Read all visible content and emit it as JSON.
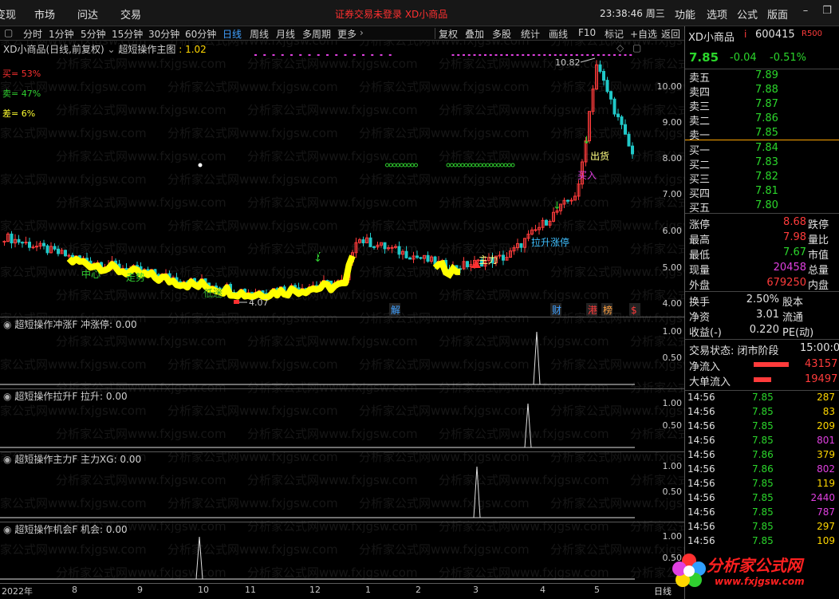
{
  "menu": {
    "items": [
      "变现",
      "市场",
      "问达",
      "交易"
    ],
    "status": "证券交易未登录  XD小商品",
    "clock": "23:38:46 周三",
    "right_items": [
      "功能",
      "选项",
      "公式",
      "版面"
    ]
  },
  "toolbar": {
    "periods": [
      "分时",
      "1分钟",
      "5分钟",
      "15分钟",
      "30分钟",
      "60分钟",
      "日线",
      "周线",
      "月线",
      "多周期",
      "更多"
    ],
    "active": "日线",
    "tools": [
      "复权",
      "叠加",
      "多股",
      "统计",
      "画线",
      "F10",
      "标记",
      "+自选",
      "返回"
    ]
  },
  "main_chart": {
    "stock": "XD小商品(日线,前复权)",
    "indicator": "超短操作主图",
    "indicator_value": "1.02",
    "signals": [
      {
        "label": "买= 53%",
        "cls": "sell"
      },
      {
        "label": "卖= 47%",
        "cls": "buy"
      },
      {
        "label": "差= 6%",
        "cls": "diff"
      }
    ],
    "high_label": "10.82",
    "low_label": "4.07",
    "annotations": {
      "chuhuo": "出货",
      "mairu": "买入",
      "lasheng": "拉升涨停",
      "zhuli": "主力",
      "zhongxin": "中心",
      "zoushi": "走势",
      "jiaxia": "低迷"
    },
    "event_tags": [
      "解",
      "财",
      "港",
      "榜",
      "$"
    ],
    "price_axis": [
      "10.00",
      "9.00",
      "8.00",
      "7.00",
      "6.00",
      "5.00",
      "4.00"
    ]
  },
  "sub_panes": [
    {
      "name": "超短操作冲涨F",
      "label": "冲涨停: 0.00",
      "axis": [
        "1.00",
        "0.50"
      ]
    },
    {
      "name": "超短操作拉升F",
      "label": "拉升: 0.00",
      "axis": [
        "1.00",
        "0.50"
      ]
    },
    {
      "name": "超短操作主力F",
      "label": "主力XG: 0.00",
      "axis": [
        "1.00",
        "0.50"
      ]
    },
    {
      "name": "超短操作机会F",
      "label": "机会: 0.00",
      "axis": [
        "1.00",
        "0.50"
      ]
    }
  ],
  "x_axis": [
    "2022年",
    "8",
    "9",
    "10",
    "11",
    "12",
    "1",
    "2",
    "3",
    "4",
    "5"
  ],
  "x_axis_corner": "日线",
  "quote": {
    "name": "XD小商品",
    "flag": "i",
    "code": "600415",
    "rating": "R500",
    "price": "7.85",
    "change": "-0.04",
    "pct": "-0.51%",
    "asks": [
      {
        "k": "卖五",
        "p": "7.89"
      },
      {
        "k": "卖四",
        "p": "7.88"
      },
      {
        "k": "卖三",
        "p": "7.87"
      },
      {
        "k": "卖二",
        "p": "7.86"
      },
      {
        "k": "卖一",
        "p": "7.85"
      }
    ],
    "bids": [
      {
        "k": "买一",
        "p": "7.84"
      },
      {
        "k": "买二",
        "p": "7.83"
      },
      {
        "k": "买三",
        "p": "7.82"
      },
      {
        "k": "买四",
        "p": "7.81"
      },
      {
        "k": "买五",
        "p": "7.80"
      }
    ],
    "stats": [
      {
        "k": "涨停",
        "v": "8.68",
        "c": "red",
        "k2": "跌停"
      },
      {
        "k": "最高",
        "v": "7.98",
        "c": "red",
        "k2": "量比"
      },
      {
        "k": "最低",
        "v": "7.67",
        "c": "green",
        "k2": "市值"
      },
      {
        "k": "现量",
        "v": "20458",
        "c": "mag",
        "k2": "总量"
      },
      {
        "k": "外盘",
        "v": "679250",
        "c": "red",
        "k2": "内盘"
      }
    ],
    "stats2": [
      {
        "k": "换手",
        "v": "2.50%",
        "c": "white",
        "k2": "股本"
      },
      {
        "k": "净资",
        "v": "3.01",
        "c": "white",
        "k2": "流通"
      },
      {
        "k": "收益(-)",
        "v": "0.220",
        "c": "white",
        "k2": "PE(动)"
      }
    ],
    "trade_state": "交易状态: 闭市阶段",
    "trade_time": "15:00:0",
    "netflow": {
      "k": "净流入",
      "v": "43157"
    },
    "bigflow": {
      "k": "大单流入",
      "v": "19497"
    },
    "ticks": [
      {
        "t": "14:56",
        "p": "7.85",
        "q": "287",
        "c": "yel"
      },
      {
        "t": "14:56",
        "p": "7.85",
        "q": "83",
        "c": "yel"
      },
      {
        "t": "14:56",
        "p": "7.85",
        "q": "209",
        "c": "yel"
      },
      {
        "t": "14:56",
        "p": "7.85",
        "q": "801",
        "c": "mag"
      },
      {
        "t": "14:56",
        "p": "7.86",
        "q": "379",
        "c": "yel"
      },
      {
        "t": "14:56",
        "p": "7.86",
        "q": "802",
        "c": "mag"
      },
      {
        "t": "14:56",
        "p": "7.85",
        "q": "119",
        "c": "yel"
      },
      {
        "t": "14:56",
        "p": "7.85",
        "q": "2440",
        "c": "mag"
      },
      {
        "t": "14:56",
        "p": "7.85",
        "q": "787",
        "c": "mag"
      },
      {
        "t": "14:56",
        "p": "7.85",
        "q": "297",
        "c": "yel"
      },
      {
        "t": "14:56",
        "p": "7.85",
        "q": "109",
        "c": "yel"
      }
    ]
  },
  "watermark": "分析家公式网www.fxjgsw.com",
  "logo": {
    "title": "分析家公式网",
    "url": "www.fxjgsw.com"
  },
  "colors": {
    "up": "#ff3b3b",
    "down": "#2bd62b",
    "yellow_band": "#ffff00",
    "grid": "#5a5a5a"
  }
}
